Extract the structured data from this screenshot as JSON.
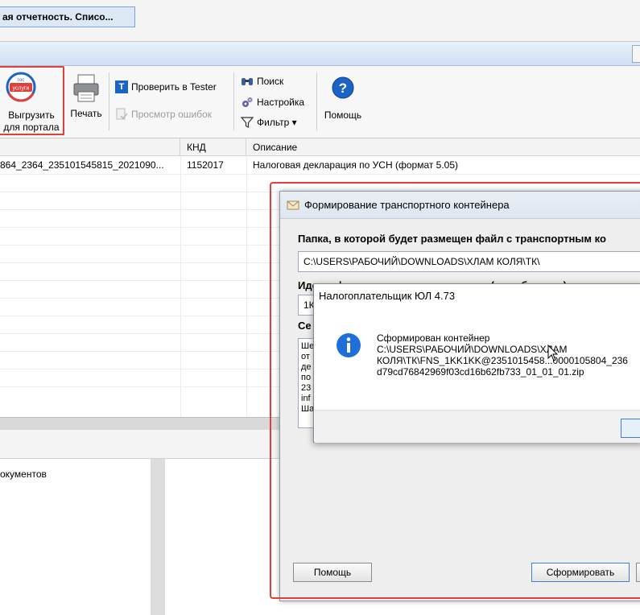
{
  "top_tab": {
    "label": "ая отчетность. Списо..."
  },
  "toolbar": {
    "export_label_1": "Выгрузить",
    "export_label_2": "для портала",
    "gos_logo_line1": "гос",
    "gos_logo_line2": "услуги",
    "print_label": "Печать",
    "check_tester_label": "Проверить в Tester",
    "view_errors_label": "Просмотр ошибок",
    "search_label": "Поиск",
    "settings_label": "Настройка",
    "filter_label": "Фильтр ▾",
    "help_label": "Помощь",
    "tester_icon_letter": "T"
  },
  "grid": {
    "columns": [
      "КНД",
      "Описание"
    ],
    "rows": [
      {
        "name": "864_2364_235101545815_2021090...",
        "knd": "1152017",
        "description": "Налоговая декларация по УСН (формат 5.05)"
      }
    ]
  },
  "lower_panel": {
    "text": "окументов"
  },
  "dialog": {
    "title": "Формирование транспортного контейнера",
    "folder_label": "Папка, в которой будет размещен файл с транспортным ко",
    "folder_value": "C:\\USERS\\РАБОЧИЙ\\DOWNLOADS\\ХЛАМ КОЛЯ\\ТК\\",
    "id_label": "Идентификатор налогоплательщика (код абонента)",
    "id_value": "1К",
    "cert_label": "Се",
    "cert_lines": [
      "Ше",
      "от",
      "де",
      "по",
      "23",
      "inf",
      "Ша"
    ],
    "help_button": "Помощь",
    "create_button": "Сформировать"
  },
  "message_box": {
    "title": "Налогоплательщик ЮЛ 4.73",
    "lines": [
      "Сформирован контейнер",
      "C:\\USERS\\РАБОЧИЙ\\DOWNLOADS\\ХЛАМ",
      "КОЛЯ\\ТК\\FNS_1KK1KK@2351015458...0000105804_236",
      "d79cd76842969f03cd16b62fb733_01_01_01.zip"
    ],
    "ok_button": ""
  },
  "colors": {
    "highlight": "#e0403a",
    "accent_blue": "#1b63c6",
    "info_blue": "#1e6fd9"
  }
}
